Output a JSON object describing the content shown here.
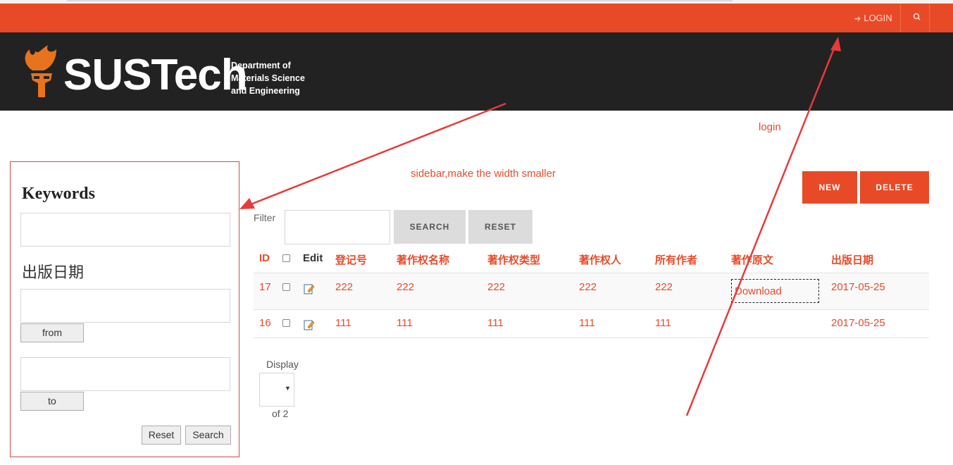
{
  "topbar": {
    "login_label": "LOGIN",
    "login_icon": "sign-in-icon",
    "search_icon": "search-icon"
  },
  "header": {
    "logo_text": "SUSTech",
    "dept_line1": "Department of",
    "dept_line2": "Materials Science",
    "dept_line3": "and Engineering"
  },
  "sidebar": {
    "keywords_title": "Keywords",
    "date_title": "出版日期",
    "from_label": "from",
    "to_label": "to",
    "reset_label": "Reset",
    "search_label": "Search"
  },
  "annotations": {
    "login_note": "login",
    "sidebar_note": "sidebar,make the width smaller"
  },
  "toolbar": {
    "new_label": "NEW",
    "delete_label": "DELETE",
    "filter_label": "Filter",
    "search_label": "SEARCH",
    "reset_label": "RESET"
  },
  "table": {
    "headers": [
      "ID",
      "Edit",
      "登记号",
      "著作权名称",
      "著作权类型",
      "著作权人",
      "所有作者",
      "著作原文",
      "出版日期"
    ],
    "rows": [
      {
        "id": "17",
        "reg": "222",
        "name": "222",
        "type": "222",
        "owner": "222",
        "authors": "222",
        "original": "Download",
        "date": "2017-05-25"
      },
      {
        "id": "16",
        "reg": "111",
        "name": "111",
        "type": "111",
        "owner": "111",
        "authors": "111",
        "original": "",
        "date": "2017-05-25"
      }
    ]
  },
  "pagination": {
    "display_label": "Display",
    "selected": "",
    "of_label": "of 2"
  },
  "colors": {
    "accent": "#e84a28",
    "header_bg": "#222222",
    "annotation_red": "#e83a3a"
  }
}
